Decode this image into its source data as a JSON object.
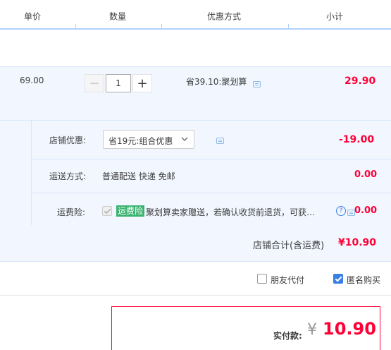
{
  "header": {
    "col_price": "单价",
    "col_qty": "数量",
    "col_discount": "优惠方式",
    "col_subtotal": "小计"
  },
  "item": {
    "unit_price": "69.00",
    "qty_minus": "−",
    "qty_value": "1",
    "qty_plus": "+",
    "promo": "省39.10:聚划算",
    "subtotal": "29.90"
  },
  "shop": {
    "discount_label": "店铺优惠:",
    "discount_select": "省19元:组合优惠",
    "discount_amount": "-19.00",
    "shipping_label": "运送方式:",
    "shipping_value": "普通配送 快递 免邮",
    "shipping_amount": "0.00",
    "insurance_label": "运费险:",
    "insurance_badge": "运费险",
    "insurance_text": "聚划算卖家赠送，若确认收货前退货，可获…",
    "insurance_amount": "0.00",
    "total_label": "店铺合计(含运费)",
    "total_value": "¥10.90",
    "help_symbol": "?"
  },
  "options": {
    "friend_pay": "朋友代付",
    "anonymous": "匿名购买"
  },
  "payment": {
    "label": "实付款:",
    "currency": "¥",
    "amount": "10.90"
  },
  "colors": {
    "accent_blue": "#3a7fe6",
    "price_red": "#ff0036",
    "row_bg": "#f2f7ff",
    "badge_green": "#3cb371"
  }
}
